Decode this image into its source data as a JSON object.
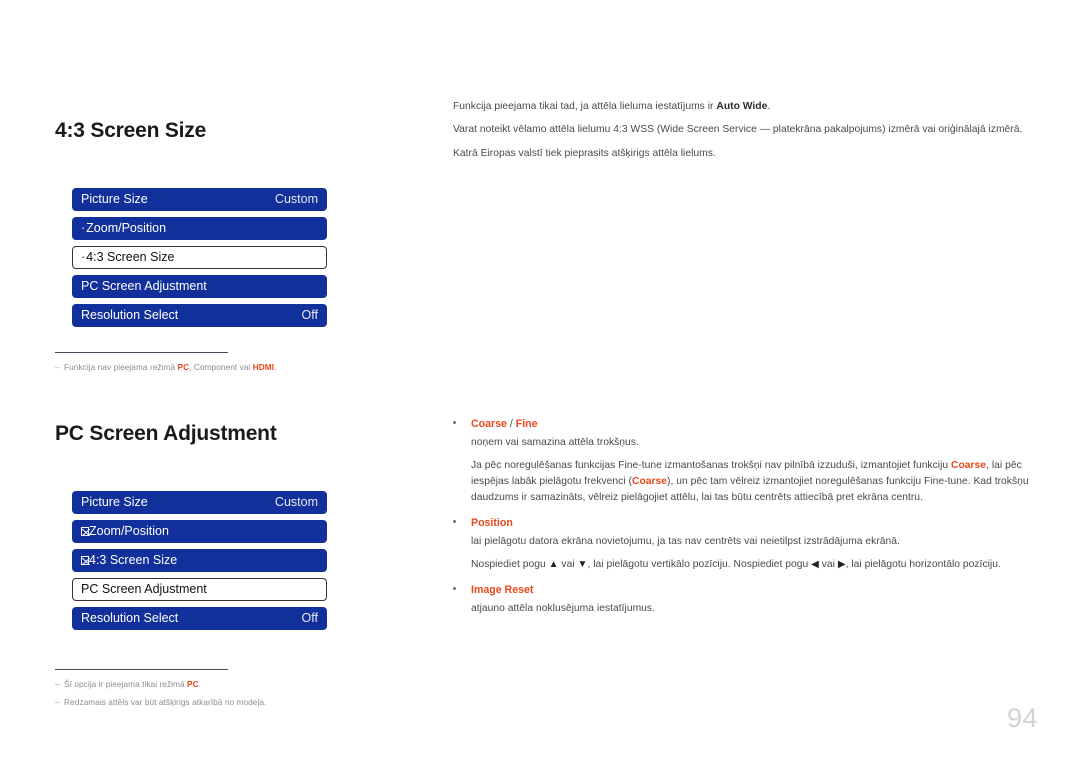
{
  "page": {
    "number": "94"
  },
  "sections": [
    {
      "heading": "4:3 Screen Size",
      "menu": {
        "rows": [
          {
            "prefix": "",
            "label": "Picture Size",
            "value": "Custom",
            "selected": false
          },
          {
            "prefix": "· ",
            "label": "Zoom/Position",
            "value": "",
            "selected": false
          },
          {
            "prefix": "· ",
            "label": "4:3 Screen Size",
            "value": "",
            "selected": true
          },
          {
            "prefix": "",
            "label": "PC Screen Adjustment",
            "value": "",
            "selected": false
          },
          {
            "prefix": "",
            "label": "Resolution Select",
            "value": "Off",
            "selected": false
          }
        ]
      },
      "footnotes": [
        {
          "dash": "–",
          "parts": [
            {
              "t": "Funkcija nav pieejama režimā ",
              "hl": false
            },
            {
              "t": "PC",
              "hl": true
            },
            {
              "t": ", Component vai ",
              "hl": false
            },
            {
              "t": "HDMI",
              "hl": true
            },
            {
              "t": ".",
              "hl": false
            }
          ]
        }
      ]
    },
    {
      "heading": "PC Screen Adjustment",
      "menu": {
        "rows": [
          {
            "prefix": "",
            "label": "Picture Size",
            "value": "Custom",
            "selected": false
          },
          {
            "prefix": "tofu",
            "label": "Zoom/Position",
            "value": "",
            "selected": false
          },
          {
            "prefix": "tofu",
            "label": "4:3 Screen Size",
            "value": "",
            "selected": false
          },
          {
            "prefix": "",
            "label": "PC Screen Adjustment",
            "value": "",
            "selected": true
          },
          {
            "prefix": "",
            "label": "Resolution Select",
            "value": "Off",
            "selected": false
          }
        ]
      },
      "footnotes": [
        {
          "dash": "–",
          "parts": [
            {
              "t": "Šī opcija ir pieejama tikai režimā ",
              "hl": false
            },
            {
              "t": "PC",
              "hl": true
            },
            {
              "t": ".",
              "hl": false
            }
          ]
        },
        {
          "dash": "–",
          "parts": [
            {
              "t": "Redzamais attēls var būt atšķirigs atkarībā no modeļa.",
              "hl": false
            }
          ]
        }
      ]
    }
  ],
  "intro": {
    "paragraphs": [
      [
        {
          "t": "Funkcija pieejama tikai tad, ja attēla lieluma iestatījums ir ",
          "b": false
        },
        {
          "t": "Auto Wide",
          "b": true
        },
        {
          "t": ".",
          "b": false
        }
      ],
      [
        {
          "t": "Varat noteikt vēlamo attēla lielumu 4:3 WSS (Wide Screen Service — platekrāna pakalpojums) izmērā vai oriģinālajā izmērā.",
          "b": false
        }
      ],
      [
        {
          "t": "Katrā Eiropas valstī tiek pieprasits atšķirigs attēla lielums.",
          "b": false
        }
      ]
    ]
  },
  "bullets": [
    {
      "title_parts": [
        {
          "t": "Coarse",
          "style": "hl"
        },
        {
          "t": " / ",
          "style": "sep"
        },
        {
          "t": "Fine",
          "style": "hl"
        }
      ],
      "body": [
        [
          {
            "t": "noņem vai samazina attēla trokšņus.",
            "b": false
          }
        ],
        [
          {
            "t": "Ja pēc noregulēšanas funkcijas Fine-tune izmantošanas trokšņi nav pilnībā izzuduši, izmantojiet funkciju ",
            "b": false
          },
          {
            "t": "Coarse",
            "b": true
          },
          {
            "t": ", lai pēc iespējas labāk pielāgotu frekvenci (",
            "b": false
          },
          {
            "t": "Coarse",
            "b": true
          },
          {
            "t": "), un pēc tam vēlreiz izmantojiet noregulēšanas funkciju Fine-tune. Kad trokšņu daudzums ir samazināts, vēlreiz pielāgojiet attēlu, lai tas būtu centrēts attiecībā pret ekrāna centru.",
            "b": false
          }
        ]
      ]
    },
    {
      "title_parts": [
        {
          "t": "Position",
          "style": "hl"
        }
      ],
      "body": [
        [
          {
            "t": "lai pielāgotu datora ekrāna novietojumu, ja tas nav centrēts vai neietilpst izstrādājuma ekrānā.",
            "b": false
          }
        ],
        [
          {
            "t": "Nospiediet pogu ",
            "b": false
          },
          {
            "t": "▲",
            "arrow": true
          },
          {
            "t": " vai ",
            "b": false
          },
          {
            "t": "▼",
            "arrow": true
          },
          {
            "t": ", lai pielāgotu vertikālo pozīciju. Nospiediet pogu ",
            "b": false
          },
          {
            "t": "◀",
            "arrow": true
          },
          {
            "t": " vai ",
            "b": false
          },
          {
            "t": "▶",
            "arrow": true
          },
          {
            "t": ", lai pielāgotu horizontālo pozīciju.",
            "b": false
          }
        ]
      ]
    },
    {
      "title_parts": [
        {
          "t": "Image Reset",
          "style": "hl"
        }
      ],
      "body": [
        [
          {
            "t": "atjauno attēla noklusējuma iestatījumus.",
            "b": false
          }
        ]
      ]
    }
  ]
}
